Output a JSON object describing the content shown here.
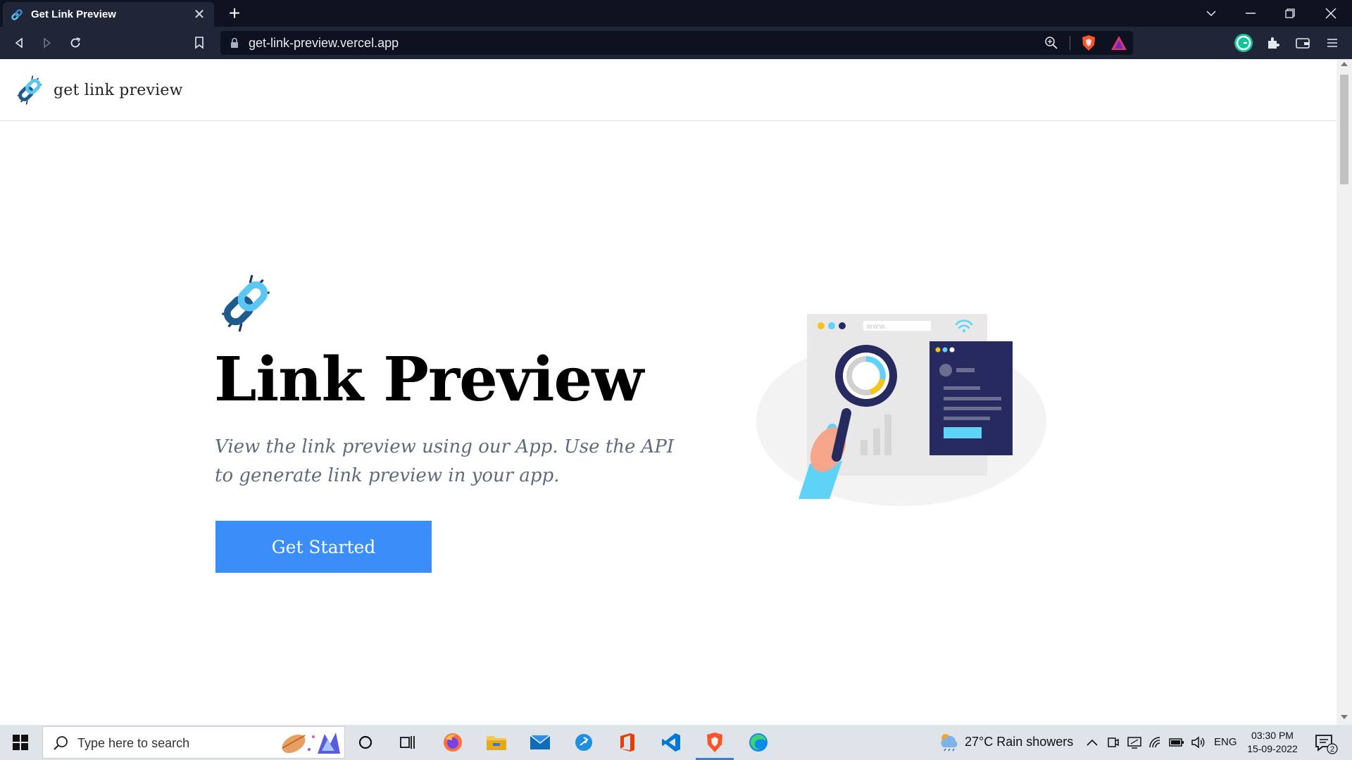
{
  "browser": {
    "tab_title": "Get Link Preview",
    "tab_close": "✕",
    "new_tab": "+",
    "url": "get-link-preview.vercel.app"
  },
  "site": {
    "brand_name": "get link preview",
    "hero_title": "Link Preview",
    "hero_subtitle": "View the link preview using our App. Use the API to generate link preview in your app.",
    "cta_label": "Get Started",
    "illustration_text": "www."
  },
  "taskbar": {
    "search_placeholder": "Type here to search",
    "weather": "27°C  Rain showers",
    "language": "ENG",
    "time": "03:30 PM",
    "date": "15-09-2022",
    "notification_count": "2"
  },
  "colors": {
    "accent": "#3b8ef9",
    "chrome_dark": "#0f1321",
    "chrome_toolbar": "#202638",
    "link_icon_light": "#5bc6f2",
    "link_icon_dark": "#1e5b8e",
    "illustration_navy": "#262a5e",
    "illustration_cyan": "#5fd3f7",
    "illustration_yellow": "#f5c518"
  },
  "icons": [
    "link-icon",
    "close-icon",
    "plus-icon",
    "chevron-down-icon",
    "minimize-icon",
    "maximize-icon",
    "back-icon",
    "forward-icon",
    "reload-icon",
    "bookmark-icon",
    "lock-icon",
    "zoom-icon",
    "brave-shield-icon",
    "brave-rewards-icon",
    "grammarly-icon",
    "extensions-icon",
    "wallet-icon",
    "menu-icon",
    "windows-icon",
    "search-icon",
    "cortana-icon",
    "task-view-icon",
    "firefox-icon",
    "file-explorer-icon",
    "mail-icon",
    "edge-legacy-icon",
    "office-icon",
    "vscode-icon",
    "brave-icon",
    "edge-icon",
    "weather-icon",
    "chevron-up-icon",
    "meet-icon",
    "network-icon",
    "wifi-icon",
    "battery-icon",
    "volume-icon",
    "notification-icon"
  ]
}
